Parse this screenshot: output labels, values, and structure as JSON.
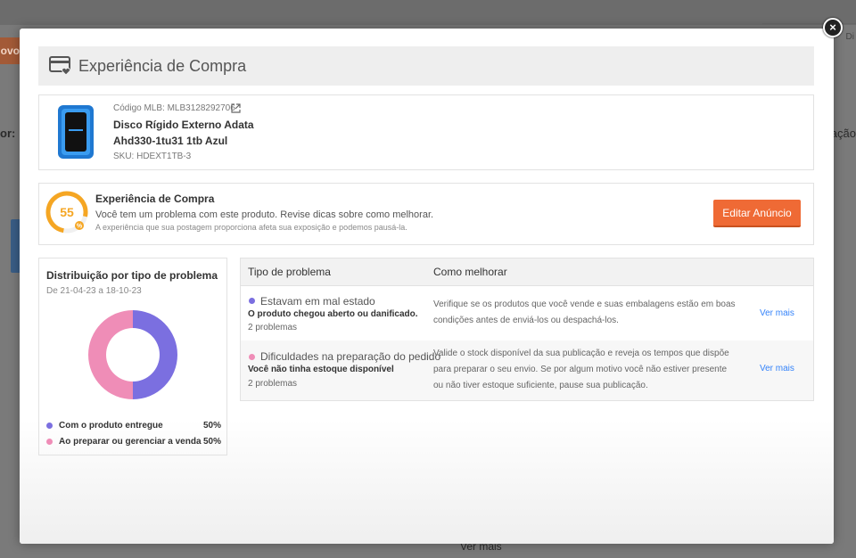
{
  "background": {
    "orange_button_fragment": "ovo",
    "left_label_fragment": "or:",
    "right_label_fragment": "cação",
    "right_input_fragment": "Di",
    "bottom_link_fragment": "Ver mais"
  },
  "modal": {
    "close_label": "×",
    "title": "Experiência de Compra"
  },
  "product": {
    "code": "Código MLB: MLB3128292706",
    "name_line1": "Disco Rígido Externo Adata",
    "name_line2": "Ahd330-1tu31 1tb Azul",
    "sku": "SKU: HDEXT1TB-3"
  },
  "experience": {
    "score": "55",
    "title": "Experiência de Compra",
    "message": "Você tem um problema com este produto. Revise dicas sobre como melhorar.",
    "note": "A experiência que sua postagem proporciona afeta sua exposição e podemos pausá-la.",
    "edit_button": "Editar Anúncio"
  },
  "distribution": {
    "title": "Distribuição por tipo de problema",
    "date_range": "De 21-04-23 a 18-10-23",
    "items": [
      {
        "label": "Com o produto entregue",
        "value": "50%",
        "percent": 50,
        "color": "#7b6fe0"
      },
      {
        "label": "Ao preparar ou gerenciar a venda",
        "value": "50%",
        "percent": 50,
        "color": "#ef8db7"
      }
    ]
  },
  "problems": {
    "headers": {
      "type": "Tipo de problema",
      "improve": "Como melhorar"
    },
    "rows": [
      {
        "title": "Estavam em mal estado",
        "subtitle": "O produto chegou aberto ou danificado.",
        "count": "2 problemas",
        "tip": "Verifique se os produtos que você vende e suas embalagens estão em boas condições antes de enviá-los ou despachá-los.",
        "link": "Ver mais",
        "color": "#7b6fe0"
      },
      {
        "title": "Dificuldades na preparação do pedido",
        "subtitle": "Você não tinha estoque disponível",
        "count": "2 problemas",
        "tip": "Valide o stock disponível da sua publicação e reveja os tempos que dispõe para preparar o seu envio. Se por algum motivo você não estiver presente ou não tiver estoque suficiente, pause sua publicação.",
        "link": "Ver mais",
        "color": "#ef8db7"
      }
    ]
  },
  "colors": {
    "accent_orange": "#ef6a35",
    "score_ring": "#f5a623",
    "link_blue": "#3483fa"
  },
  "icons": {
    "header": "card-heart-icon",
    "external": "external-link-icon",
    "close": "close-icon"
  }
}
